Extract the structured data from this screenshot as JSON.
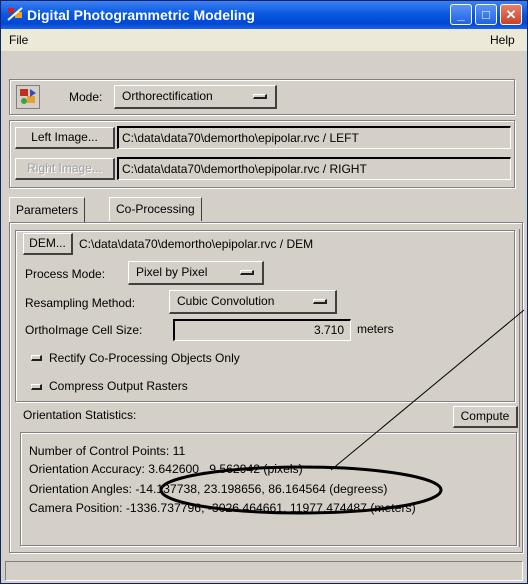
{
  "window": {
    "title": "Digital Photogrammetric Modeling",
    "icon": "pdm-app-icon",
    "controls": [
      "minimize-icon",
      "maximize-icon",
      "close-icon"
    ]
  },
  "menubar": {
    "file": "File",
    "help": "Help"
  },
  "mode": {
    "icon": "mode-toolbar-icon",
    "label": "Mode:",
    "value": "Orthorectification"
  },
  "images": {
    "left_button": "Left Image...",
    "left_path": "C:\\data\\data70\\demortho\\epipolar.rvc / LEFT",
    "right_button": "Right Image...",
    "right_path": "C:\\data\\data70\\demortho\\epipolar.rvc / RIGHT"
  },
  "tabs": [
    {
      "label": "Parameters",
      "active": true
    },
    {
      "label": "Co-Processing",
      "active": false
    }
  ],
  "parameters": {
    "dem_button": "DEM...",
    "dem_path": "C:\\data\\data70\\demortho\\epipolar.rvc / DEM",
    "process_mode_label": "Process Mode:",
    "process_mode_value": "Pixel by Pixel",
    "resampling_label": "Resampling Method:",
    "resampling_value": "Cubic Convolution",
    "cell_size_label": "OrthoImage Cell Size:",
    "cell_size_value": "3.710",
    "cell_size_units": "meters",
    "rectify_only_label": "Rectify Co-Processing Objects Only",
    "compress_label": "Compress Output Rasters"
  },
  "orientation": {
    "label": "Orientation Statistics:",
    "compute_button": "Compute",
    "lines": [
      "Number of Control Points: 11",
      "Orientation Accuracy: 3.642600 , 9.562942 (pixels)",
      "Orientation Angles: -14.137738, 23.198656, 86.164564 (degreess)",
      "Camera Position: -1336.737796, -3026.464661, 11977.474487 (meters)"
    ]
  },
  "annotation": {
    "color": "#000000"
  },
  "colors": {
    "titlebar": "#0a5ae0",
    "window_bg": "#d4d0c8"
  }
}
